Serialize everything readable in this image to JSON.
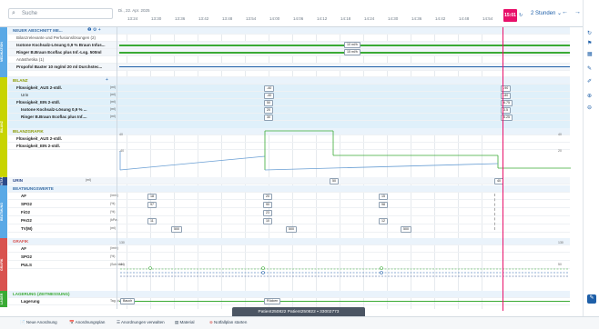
{
  "header": {
    "search_placeholder": "Suche",
    "date": "Di., 22. Apr. 2025",
    "times": [
      "13:24",
      "13:30",
      "13:36",
      "13:42",
      "13:48",
      "13:54",
      "14:00",
      "14:06",
      "14:12",
      "14:18",
      "14:24",
      "14:30",
      "14:36",
      "14:42",
      "14:48",
      "14:54"
    ],
    "current_time": "15:01",
    "zoom": "2 Stunden"
  },
  "sections": {
    "medication_tab": "MEDIKATION",
    "bilanz_tab": "BILANZ",
    "vital_tab": "VITAL",
    "beatmung_tab": "BEATMUNG",
    "grafik_tab": "GRAFIK",
    "lager_tab": "LAGER"
  },
  "rows": {
    "r1": "NEUER ABSCHNITT ME...",
    "r2": "Bilanzrelevante und Perfusionslösungen (2)",
    "r3": "Isotone Kochsalz-Lösung 0,9 % Braun Infus...",
    "r4": "Ringer B.Braun Ecoflac plus Inf.-Lsg. 500ml",
    "r5": "Anästhetika (1)",
    "r6": "Propofol Baxter 10 mg/ml 20 ml Durchstec...",
    "r7": "BILANZ",
    "r8": "Flüssigkeit_AUS 2-stdl.",
    "r9": "Urin",
    "r10": "Flüssigkeit_EIN 2-stdl.",
    "r11": "Isotone Kochsalz-Lösung 0,9 % ...",
    "r12": "Ringer B.Braun Ecoflac plus Inf....",
    "r13": "BILANZGRAFIK",
    "r14": "Flüssigkeit_AUS 2-stdl.",
    "r15": "Flüssigkeit_EIN 2-stdl.",
    "r16": "URIN",
    "r17": "BEATMUNGSWERTE",
    "r18": "AF",
    "r19": "SPO2",
    "r20": "FiO2",
    "r21": "PAO2",
    "r22": "TV(M)",
    "r23": "GRAFIK",
    "r24": "AF",
    "r25": "SPO2",
    "r26": "PULS",
    "r27": "LAGERUNG (ZEITMESSUNG)",
    "r28": "Lagerung"
  },
  "units": {
    "u_ml": "(ml)",
    "u_min": "(/min)",
    "u_pct": "(%)",
    "u_kpa": "(kPa)",
    "u_tv": "(ml)",
    "u_bpm": "(Schl/min)",
    "u_tag": "Tag 4d"
  },
  "values": {
    "inf1": "10 ml/h",
    "inf2": "15 ml/h",
    "aus1": "-40",
    "aus2": "-90",
    "urin1": "-40",
    "urin2": "-80",
    "ein1": "50",
    "ein2": "6.75",
    "iso1": "20",
    "iso2": "3.5",
    "ring1": "30",
    "ring2": "5.25",
    "urin_b1": "50",
    "urin_b2": "40",
    "af1": "18",
    "af2": "20",
    "af3": "15",
    "spo1": "97",
    "spo2": "90",
    "spo3": "98",
    "fio": "23",
    "pao1": "11",
    "pao2": "10",
    "pao3": "12",
    "tv1": "500",
    "tv2": "500",
    "tv3": "500",
    "lager1": "Bauch",
    "lager2": "Rücken",
    "axis_top1": "40",
    "axis_mid1": "-40",
    "axis_top2": "40",
    "axis_mid2": "20",
    "axis_g1": "130",
    "axis_g2": "110",
    "axis_g3": "50"
  },
  "footer": {
    "b1": "Neue Anordnung",
    "b2": "Anordnungsplan",
    "b3": "Anordnungen verwalten",
    "b4": "Material",
    "b5": "Notfallplan starten",
    "patient": "Patient250822 Patient250822",
    "patient_id": "33002773"
  },
  "colors": {
    "accent": "#1e5fa8",
    "current": "#e8106a",
    "green": "#3aaa35",
    "bilanz": "#c8d400",
    "beat": "#5aa9e6",
    "grafik": "#d9534f"
  }
}
